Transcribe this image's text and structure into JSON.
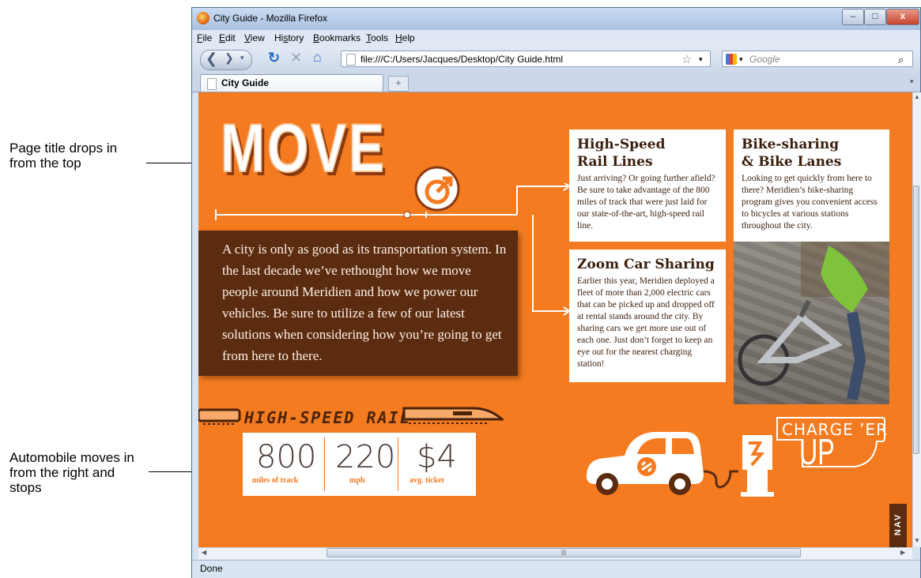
{
  "callouts": [
    {
      "text": "Page title drops in\nfrom the top"
    },
    {
      "text": "Automobile moves in\nfrom the right and\nstops"
    }
  ],
  "window": {
    "title": "City Guide - Mozilla Firefox",
    "controls": [
      "–",
      "□",
      "x"
    ]
  },
  "menu": {
    "items": [
      {
        "label": "File",
        "key": "F",
        "rest": "ile"
      },
      {
        "label": "Edit",
        "key": "E",
        "rest": "dit"
      },
      {
        "label": "View",
        "key": "V",
        "rest": "iew"
      },
      {
        "label": "History",
        "key": "s",
        "pre": "Hi",
        "rest": "tory"
      },
      {
        "label": "Bookmarks",
        "key": "B",
        "rest": "ookmarks"
      },
      {
        "label": "Tools",
        "key": "T",
        "rest": "ools"
      },
      {
        "label": "Help",
        "key": "H",
        "rest": "elp"
      }
    ]
  },
  "navbar": {
    "url": "file:///C:/Users/Jacques/Desktop/City Guide.html",
    "search_placeholder": "Google"
  },
  "tabs": [
    {
      "label": "City Guide"
    }
  ],
  "status": "Done",
  "page": {
    "title": "MOVE",
    "intro": "A city is only as good as its transportation system. In the last decade we’ve rethought  how we move people around Meridien and how we power our vehicles.  Be sure to utilize a few of our latest solutions when considering how you’re going to get from here to there.",
    "cards": [
      {
        "title": "High-Speed\nRail Lines",
        "body": "Just arriving? Or going further afield? Be sure to take advantage of the 800 miles of track that were just laid for our state-of-the-art, high-speed rail line."
      },
      {
        "title": "Bike-sharing\n& Bike Lanes",
        "body": "Looking to get quickly from here to there? Meridien’s bike-sharing program gives you convenient access to bicycles at various stations throughout the city."
      },
      {
        "title": "Zoom Car Sharing",
        "body": "Earlier this year, Meridien deployed a fleet of more than 2,000 electric cars that can be picked up and dropped off at rental stands around the city. By sharing cars we get more use out of each one. Just don’t forget to keep an eye out for the nearest charging station!"
      }
    ],
    "rail_label": "HIGH-SPEED RAIL",
    "stats": [
      {
        "value": "800",
        "label": "miles of track"
      },
      {
        "value": "220",
        "label": "mph"
      },
      {
        "value": "$4",
        "label": "avg. ticket"
      }
    ],
    "charge_label": "CHARGE ’ER",
    "up_label": "UP",
    "nav_label": "NAV"
  },
  "colors": {
    "page_bg": "#f47b20",
    "dark_brown": "#5c2c10",
    "white": "#ffffff"
  }
}
